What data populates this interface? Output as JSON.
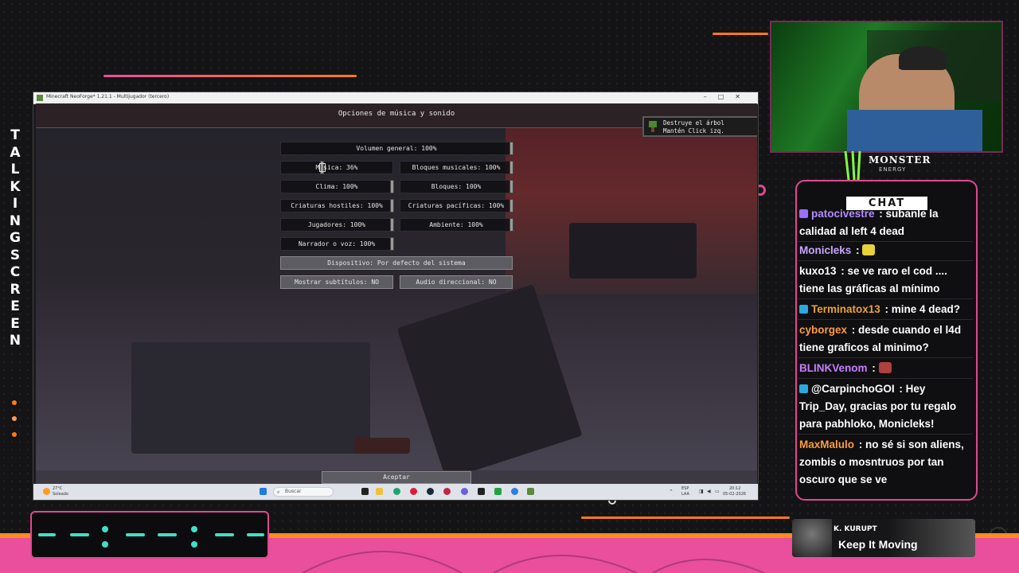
{
  "overlay": {
    "side_text_letters": [
      "T",
      "A",
      "L",
      "K",
      "I",
      "N",
      "G",
      "S",
      "C",
      "R",
      "E",
      "E",
      "N"
    ],
    "colors": {
      "accent_pink": "#e0488f",
      "accent_orange": "#ff7a1a",
      "teal": "#40e0c8",
      "chat_bg": "#0f0f11"
    }
  },
  "game": {
    "window_title": "Minecraft NeoForge* 1.21.1 - Multijugador (tercero)",
    "screen_title": "Opciones de música y sonido",
    "toast": {
      "line1": "Destruye el árbol",
      "line2": "Mantén Click izq."
    },
    "options": {
      "master": "Volumen general: 100%",
      "music": "Música: 36%",
      "jukebox": "Bloques musicales: 100%",
      "weather": "Clima: 100%",
      "blocks": "Bloques: 100%",
      "hostile": "Criaturas hostiles: 100%",
      "friendly": "Criaturas pacíficas: 100%",
      "players": "Jugadores: 100%",
      "ambient": "Ambiente: 100%",
      "voice": "Narrador o voz: 100%",
      "device": "Dispositivo: Por defecto del sistema",
      "subtitles": "Mostrar subtítulos: NO",
      "directional": "Audio direccional: NO"
    },
    "slider_levels": {
      "master": 1.0,
      "music": 0.36,
      "jukebox": 1.0,
      "weather": 1.0,
      "blocks": 1.0,
      "hostile": 1.0,
      "friendly": 1.0,
      "players": 1.0,
      "ambient": 1.0,
      "voice": 1.0
    },
    "done_button": "Aceptar"
  },
  "taskbar": {
    "weather_temp": "27°C",
    "weather_desc": "Soleado",
    "search_placeholder": "Buscar",
    "lang": "ESP",
    "lang2": "LAA",
    "time": "20:12",
    "date": "05-02-2026"
  },
  "chat": {
    "title": "CHAT",
    "messages": [
      {
        "user": "patocivestre",
        "text": "subanle la calidad al left 4 dead",
        "color": "#b48cff",
        "badge": true
      },
      {
        "user": "Monicleks",
        "text": "",
        "color": "#c7a6ff",
        "emote": true
      },
      {
        "user": "kuxo13",
        "text": "se ve raro el cod .... tiene las gráficas al mínimo",
        "color": "#ffffff"
      },
      {
        "user": "Terminatox13",
        "text": "mine 4 dead?",
        "color": "#e8a23a",
        "badge": true
      },
      {
        "user": "cyborgex",
        "text": "desde cuando el l4d tiene graficos al minimo?",
        "color": "#ff9b3d"
      },
      {
        "user": "BLINKVenom",
        "text": "",
        "color": "#c77dff",
        "emote": true
      },
      {
        "user": "@CarpinchoGOI",
        "text": "Hey Trip_Day, gracias por tu regalo para pabhloko, Monicleks!",
        "color": "#ffffff",
        "badge": true
      },
      {
        "user": "MaxMalulo",
        "text": "no sé si son aliens, zombis o mosntruos por tan oscuro que se ve",
        "color": "#ff9b3d"
      }
    ]
  },
  "sponsor": {
    "brand": "MONSTER",
    "sub": "ENERGY"
  },
  "now_playing": {
    "artist": "K. KURUPT",
    "title": "Keep It Moving"
  }
}
